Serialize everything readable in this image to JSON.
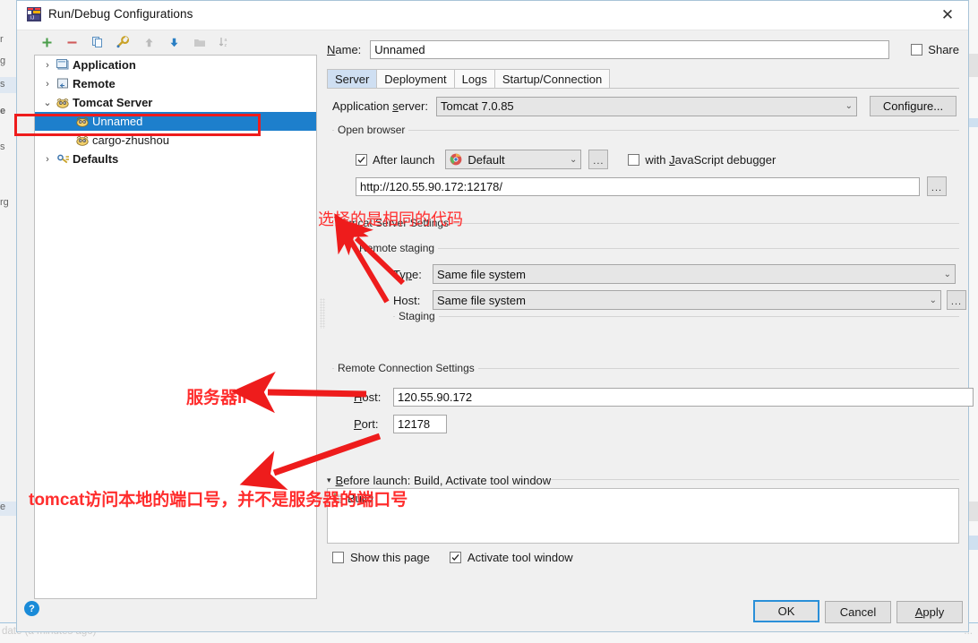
{
  "window": {
    "title": "Run/Debug Configurations",
    "close_label": "✕",
    "app_icon": "intellij-idea-icon"
  },
  "toolbar": {
    "items": [
      {
        "name": "add-button",
        "glyph": "+",
        "color": "#4a9e4a",
        "enabled": true
      },
      {
        "name": "remove-button",
        "glyph": "−",
        "color": "#d05a5a",
        "enabled": true
      },
      {
        "name": "copy-button",
        "glyph": "copy-icon",
        "color": "#5a8fc0",
        "enabled": true
      },
      {
        "name": "edit-templates-button",
        "glyph": "wrench-icon",
        "color": "#c9a227",
        "enabled": true
      },
      {
        "name": "move-up-button",
        "glyph": "arrow-up-icon",
        "color": "#b8b8b8",
        "enabled": false
      },
      {
        "name": "move-down-button",
        "glyph": "arrow-down-icon",
        "color": "#2a7fc4",
        "enabled": true
      },
      {
        "name": "folder-button",
        "glyph": "folder-icon",
        "color": "#bdbdbd",
        "enabled": false
      },
      {
        "name": "sort-button",
        "glyph": "sort-az-icon",
        "color": "#b8b8b8",
        "enabled": false
      }
    ]
  },
  "tree": {
    "nodes": [
      {
        "label": "Application",
        "icon": "application-icon",
        "twisty": "›",
        "depth": 0,
        "bold": true,
        "selected": false
      },
      {
        "label": "Remote",
        "icon": "remote-icon",
        "twisty": "›",
        "depth": 0,
        "bold": true,
        "selected": false
      },
      {
        "label": "Tomcat Server",
        "icon": "tomcat-icon",
        "twisty": "⌄",
        "depth": 0,
        "bold": true,
        "selected": false
      },
      {
        "label": "Unnamed",
        "icon": "tomcat-icon",
        "twisty": "",
        "depth": 1,
        "bold": false,
        "selected": true
      },
      {
        "label": "cargo-zhushou",
        "icon": "tomcat-icon",
        "twisty": "",
        "depth": 1,
        "bold": false,
        "selected": false
      },
      {
        "label": "Defaults",
        "icon": "defaults-icon",
        "twisty": "›",
        "depth": 0,
        "bold": true,
        "selected": false
      }
    ]
  },
  "name_row": {
    "label": "Name:",
    "value": "Unnamed",
    "share_label": "Share",
    "share_checked": false
  },
  "tabs": [
    {
      "label": "Server",
      "active": true
    },
    {
      "label": "Deployment",
      "active": false
    },
    {
      "label": "Logs",
      "active": false
    },
    {
      "label": "Startup/Connection",
      "active": false
    }
  ],
  "application_server": {
    "label": "Application server:",
    "value": "Tomcat 7.0.85",
    "configure_label": "Configure..."
  },
  "open_browser": {
    "group_title": "Open browser",
    "after_launch_label": "After launch",
    "after_launch_checked": true,
    "browser_value": "Default",
    "browser_icon": "chrome-icon",
    "dots_label": "...",
    "js_debugger_label": "with JavaScript debugger",
    "js_debugger_checked": false,
    "url_value": "http://120.55.90.172:12178/",
    "url_dots_label": "..."
  },
  "tomcat_settings": {
    "group_title": "Tomcat Server Settings",
    "remote_staging_title": "Remote staging",
    "type_label": "Type:",
    "type_value": "Same file system",
    "host_label": "Host:",
    "host_value": "Same file system",
    "host_dots_label": "...",
    "staging_title": "Staging"
  },
  "remote_connection": {
    "group_title": "Remote Connection Settings",
    "host_label": "Host:",
    "host_value": "120.55.90.172",
    "port_label": "Port:",
    "port_value": "12178"
  },
  "before_launch": {
    "twisty": "▾",
    "title": "Before launch: Build, Activate tool window",
    "items": [
      {
        "label": "Build",
        "icon": "build-icon"
      }
    ],
    "show_page_label": "Show this page",
    "show_page_checked": false,
    "activate_tool_label": "Activate tool window",
    "activate_tool_checked": true
  },
  "footer": {
    "help_label": "?",
    "ok_label": "OK",
    "cancel_label": "Cancel",
    "apply_label": "Apply"
  },
  "annotations": {
    "color": "#ff2d2d",
    "selection_box_color": "#ee1c1c",
    "notes": [
      {
        "name": "annotation-same-code",
        "text": "选择的是相同的代码"
      },
      {
        "name": "annotation-server-ip",
        "text": "服务器IP"
      },
      {
        "name": "annotation-local-port",
        "text": "tomcat访问本地的端口号，并不是服务器的端口号"
      }
    ]
  },
  "background": {
    "left_labels": [
      "r",
      "g",
      "s",
      "e",
      "s",
      "rg",
      "e",
      "d"
    ],
    "bottom_text": "date (a minutes ago)",
    "bottom_right_text": "..."
  }
}
